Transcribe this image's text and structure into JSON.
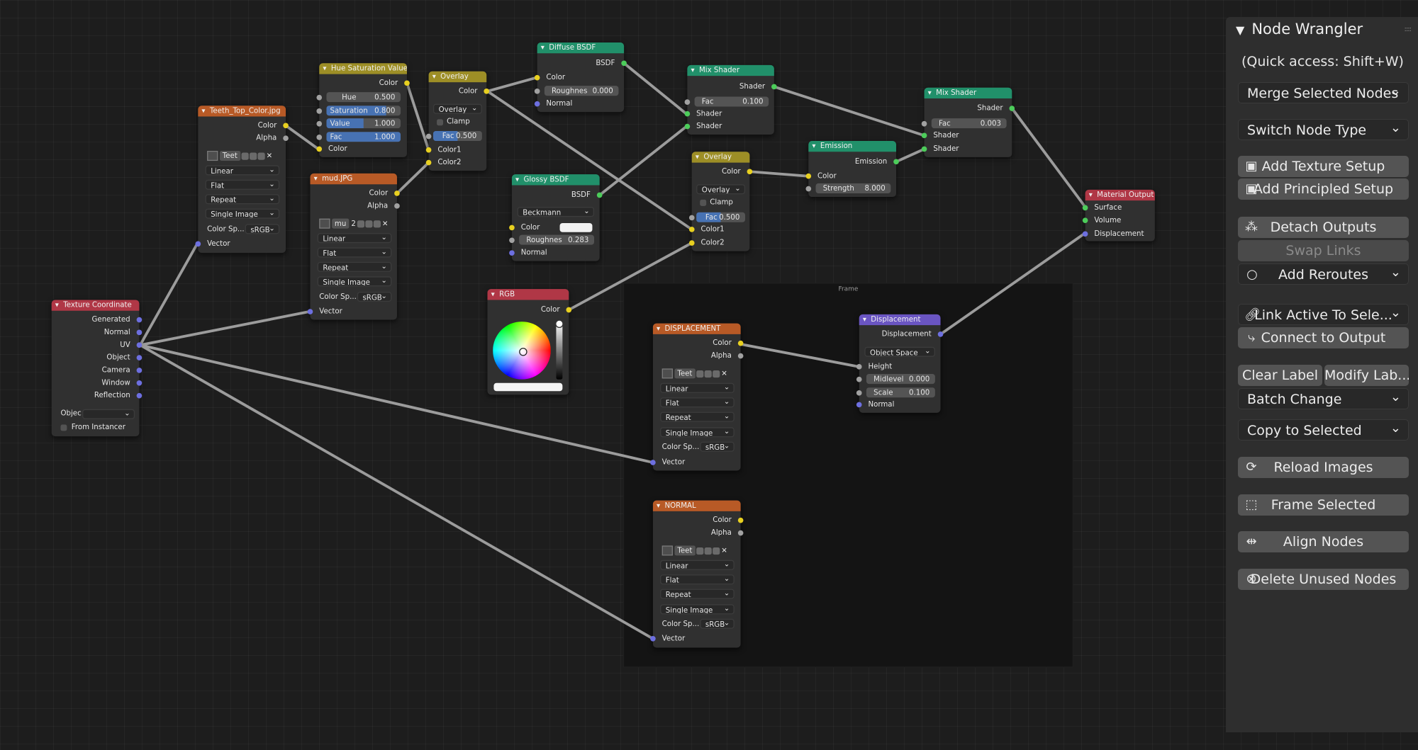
{
  "frame": {
    "title": "Frame"
  },
  "nodes": {
    "texcoord": {
      "title": "Texture Coordinate",
      "outputs": [
        "Generated",
        "Normal",
        "UV",
        "Object",
        "Camera",
        "Window",
        "Reflection"
      ],
      "object_label": "Objec",
      "from_instancer": "From Instancer"
    },
    "teeth": {
      "title": "Teeth_Top_Color.jpg",
      "out_color": "Color",
      "out_alpha": "Alpha",
      "image_name": "Teet",
      "interpolation": "Linear",
      "projection": "Flat",
      "extension": "Repeat",
      "source": "Single Image",
      "colorspace_label": "Color Sp...",
      "colorspace": "sRGB",
      "in_vector": "Vector"
    },
    "huesat": {
      "title": "Hue Saturation Value",
      "out_color": "Color",
      "hue_label": "Hue",
      "hue": "0.500",
      "sat_label": "Saturation",
      "sat": "0.800",
      "val_label": "Value",
      "val": "1.000",
      "fac_label": "Fac",
      "fac": "1.000",
      "in_color": "Color"
    },
    "mud": {
      "title": "mud.JPG",
      "out_color": "Color",
      "out_alpha": "Alpha",
      "image_name": "mu",
      "users": "2",
      "interpolation": "Linear",
      "projection": "Flat",
      "extension": "Repeat",
      "source": "Single Image",
      "colorspace_label": "Color Sp...",
      "colorspace": "sRGB",
      "in_vector": "Vector"
    },
    "overlay1": {
      "title": "Overlay",
      "out_color": "Color",
      "blend": "Overlay",
      "clamp": "Clamp",
      "fac_label": "Fac",
      "fac": "0.500",
      "in_color1": "Color1",
      "in_color2": "Color2"
    },
    "diffuse": {
      "title": "Diffuse BSDF",
      "out_bsdf": "BSDF",
      "in_color": "Color",
      "rough_label": "Roughnes",
      "rough": "0.000",
      "in_normal": "Normal"
    },
    "glossy": {
      "title": "Glossy BSDF",
      "out_bsdf": "BSDF",
      "distribution": "Beckmann",
      "in_color": "Color",
      "rough_label": "Roughnes",
      "rough": "0.283",
      "in_normal": "Normal"
    },
    "mix1": {
      "title": "Mix Shader",
      "out_shader": "Shader",
      "fac_label": "Fac",
      "fac": "0.100",
      "in_shader1": "Shader",
      "in_shader2": "Shader"
    },
    "overlay2": {
      "title": "Overlay",
      "out_color": "Color",
      "blend": "Overlay",
      "clamp": "Clamp",
      "fac_label": "Fac",
      "fac": "0.500",
      "in_color1": "Color1",
      "in_color2": "Color2"
    },
    "emission": {
      "title": "Emission",
      "out_emission": "Emission",
      "in_color": "Color",
      "strength_label": "Strength",
      "strength": "8.000"
    },
    "mix2": {
      "title": "Mix Shader",
      "out_shader": "Shader",
      "fac_label": "Fac",
      "fac": "0.003",
      "in_shader1": "Shader",
      "in_shader2": "Shader"
    },
    "matout": {
      "title": "Material Output",
      "in_surface": "Surface",
      "in_volume": "Volume",
      "in_displacement": "Displacement"
    },
    "rgb": {
      "title": "RGB",
      "out_color": "Color"
    },
    "disptex": {
      "title": "DISPLACEMENT",
      "out_color": "Color",
      "out_alpha": "Alpha",
      "image_name": "Teet",
      "interpolation": "Linear",
      "projection": "Flat",
      "extension": "Repeat",
      "source": "Single Image",
      "colorspace_label": "Color Sp...",
      "colorspace": "sRGB",
      "in_vector": "Vector"
    },
    "normaltex": {
      "title": "NORMAL",
      "out_color": "Color",
      "out_alpha": "Alpha",
      "image_name": "Teet",
      "interpolation": "Linear",
      "projection": "Flat",
      "extension": "Repeat",
      "source": "Single Image",
      "colorspace_label": "Color Sp...",
      "colorspace": "sRGB",
      "in_vector": "Vector"
    },
    "displacement": {
      "title": "Displacement",
      "out_displacement": "Displacement",
      "space": "Object Space",
      "in_height": "Height",
      "midlevel_label": "Midlevel",
      "midlevel": "0.000",
      "scale_label": "Scale",
      "scale": "0.100",
      "in_normal": "Normal"
    }
  },
  "colors": {
    "socket_color": "#e8d020",
    "socket_shader": "#4ccc5a",
    "socket_vector": "#6d6fe0",
    "socket_float": "#a1a1a1",
    "header_texture": "#b85a26",
    "header_color": "#9d8e26",
    "header_shader": "#21906a",
    "header_input_output": "#b03746",
    "header_vector": "#6a55c2",
    "field_active": "#4772b3"
  },
  "panel": {
    "title": "Node Wrangler",
    "quick_access": "(Quick access: Shift+W)",
    "merge": "Merge Selected Nodes",
    "switch": "Switch Node Type",
    "add_texture": "Add Texture Setup",
    "add_principled": "Add Principled Setup",
    "detach": "Detach Outputs",
    "swap": "Swap Links",
    "add_reroutes": "Add Reroutes",
    "link_active": "Link Active To Sele...",
    "connect_output": "Connect to Output",
    "clear_label": "Clear Label",
    "modify_label": "Modify Lab...",
    "batch_change": "Batch Change",
    "copy_selected": "Copy to Selected",
    "reload": "Reload Images",
    "frame_selected": "Frame Selected",
    "align": "Align Nodes",
    "delete_unused": "Delete Unused Nodes"
  }
}
